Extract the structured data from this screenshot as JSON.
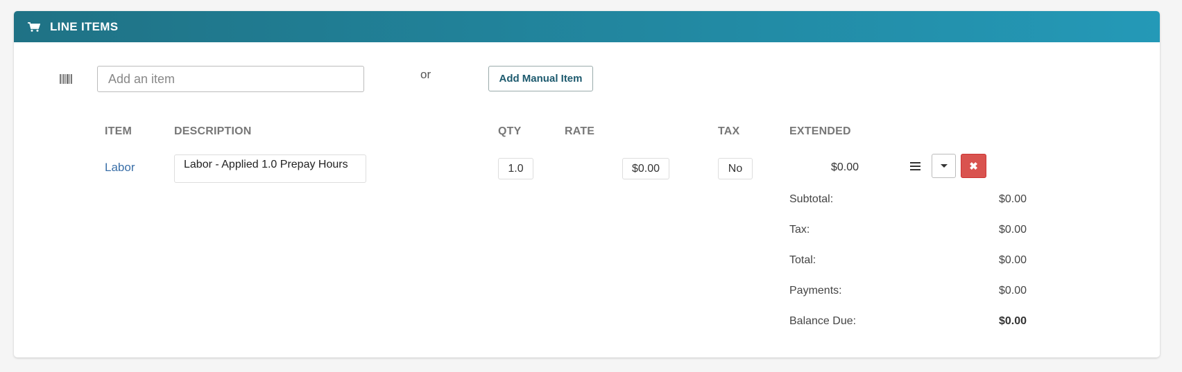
{
  "panel": {
    "title": "LINE ITEMS",
    "icon": "shopping-cart-icon"
  },
  "add_item": {
    "placeholder": "Add an item",
    "or_text": "or",
    "manual_button": "Add Manual Item",
    "barcode_icon": "barcode-icon"
  },
  "table": {
    "headers": [
      "ITEM",
      "DESCRIPTION",
      "QTY",
      "RATE",
      "TAX",
      "EXTENDED"
    ],
    "rows": [
      {
        "item": "Labor",
        "description": "Labor - Applied 1.0 Prepay Hours",
        "qty": "1.0",
        "rate": "$0.00",
        "tax": "No",
        "extended": "$0.00"
      }
    ]
  },
  "summary": [
    {
      "label": "Subtotal:",
      "value": "$0.00"
    },
    {
      "label": "Tax:",
      "value": "$0.00"
    },
    {
      "label": "Total:",
      "value": "$0.00"
    },
    {
      "label": "Payments:",
      "value": "$0.00"
    },
    {
      "label": "Balance Due:",
      "value": "$0.00"
    }
  ],
  "colors": {
    "header_start": "#1f7285",
    "header_end": "#2499b7",
    "delete": "#d9534f",
    "link": "#3a6fa8"
  }
}
